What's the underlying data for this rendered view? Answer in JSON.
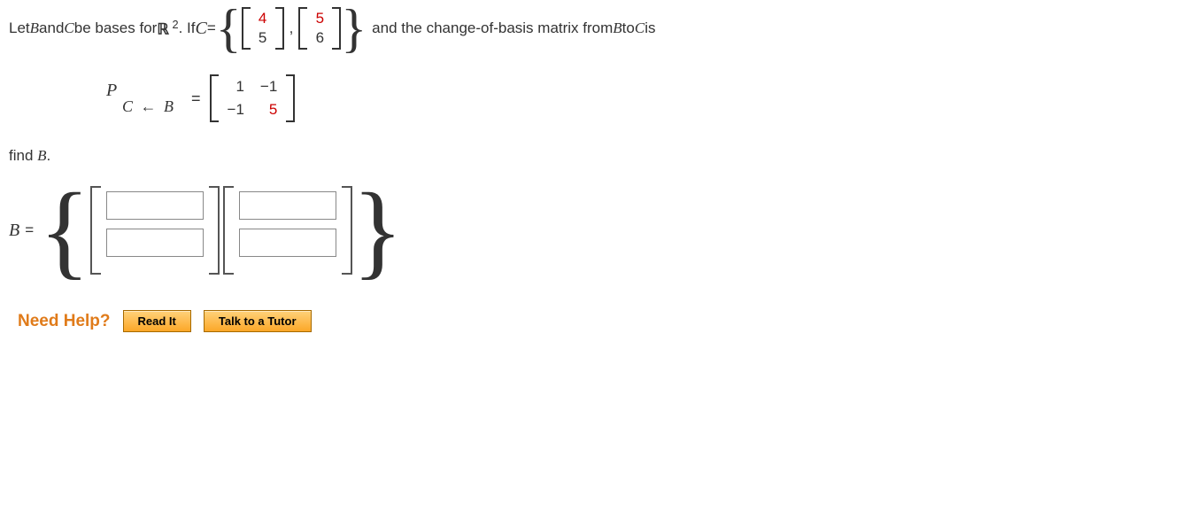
{
  "problem": {
    "intro_a": "Let ",
    "intro_b": " and ",
    "intro_c": " be bases for ",
    "space_R": "ℝ",
    "space_exp": "2",
    "intro_d": ". If ",
    "eq1": " = ",
    "C_vec1": {
      "top": "4",
      "bot": "5"
    },
    "comma": ",",
    "C_vec2": {
      "top": "5",
      "bot": "6"
    },
    "intro_e": " and the change-of-basis matrix from ",
    "intro_f": " to ",
    "intro_g": " is",
    "P_label": "P",
    "P_sub_left": "C",
    "P_sub_arrow": "←",
    "P_sub_right": "B",
    "eq2": "=",
    "P_matrix": {
      "r1c1": "1",
      "r1c2": "−1",
      "r2c1": "−1",
      "r2c2": "5"
    },
    "task": "find ",
    "task_end": ".",
    "answer_lhs": " = "
  },
  "help": {
    "label": "Need Help?",
    "read": "Read It",
    "tutor": "Talk to a Tutor"
  },
  "glyph": {
    "B": "B",
    "C": "C"
  }
}
